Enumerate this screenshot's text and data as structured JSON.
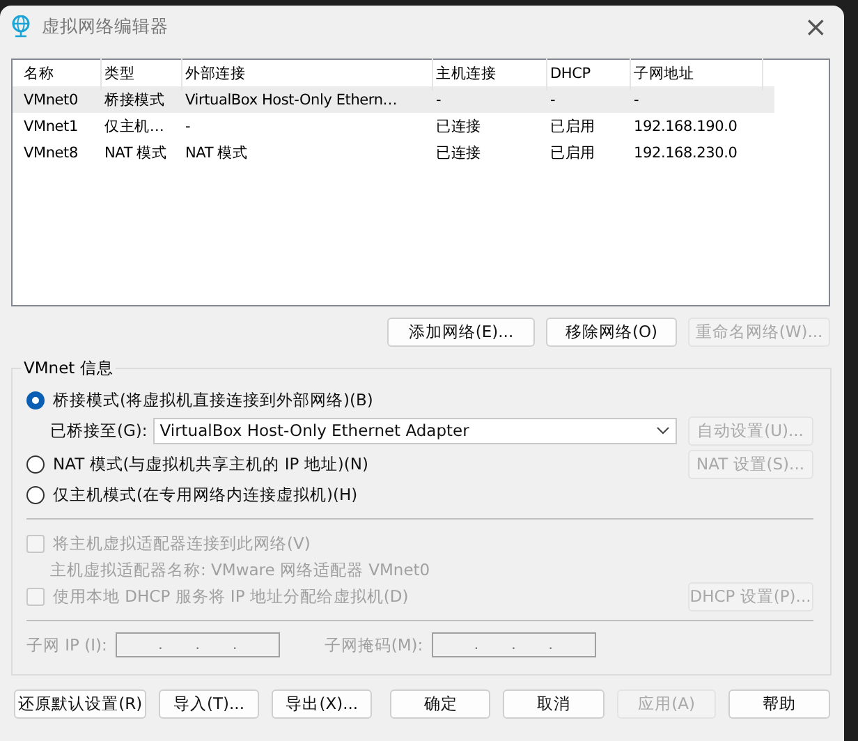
{
  "window": {
    "title": "虚拟网络编辑器",
    "close": "×"
  },
  "table": {
    "columns": [
      "名称",
      "类型",
      "外部连接",
      "主机连接",
      "DHCP",
      "子网地址"
    ],
    "rows": [
      {
        "cells": [
          "VMnet0",
          "桥接模式",
          "VirtualBox Host-Only Ethern…",
          "-",
          "-",
          "-"
        ],
        "selected": true
      },
      {
        "cells": [
          "VMnet1",
          "仅主机…",
          "-",
          "已连接",
          "已启用",
          "192.168.190.0"
        ],
        "selected": false
      },
      {
        "cells": [
          "VMnet8",
          "NAT 模式",
          "NAT 模式",
          "已连接",
          "已启用",
          "192.168.230.0"
        ],
        "selected": false
      }
    ]
  },
  "network_buttons": [
    {
      "label": "添加网络(E)...",
      "disabled": false
    },
    {
      "label": "移除网络(O)",
      "disabled": false
    },
    {
      "label": "重命名网络(W)...",
      "disabled": true
    }
  ],
  "info": {
    "title": "VMnet 信息",
    "modes": [
      {
        "label": "桥接模式(将虚拟机直接连接到外部网络)(B)",
        "selected": true
      },
      {
        "label": "NAT 模式(与虚拟机共享主机的 IP 地址)(N)",
        "selected": false
      },
      {
        "label": "仅主机模式(在专用网络内连接虚拟机)(H)",
        "selected": false
      }
    ],
    "bridged_to": {
      "label": "已桥接至(G):",
      "value": "VirtualBox Host-Only Ethernet Adapter"
    },
    "auto_button": {
      "label": "自动设置(U)...",
      "disabled": true
    },
    "nat_button": {
      "label": "NAT 设置(S)...",
      "disabled": true
    },
    "host_adapter": {
      "label": "将主机虚拟适配器连接到此网络(V)",
      "checked": false,
      "disabled": true
    },
    "adapter_name": "主机虚拟适配器名称: VMware 网络适配器 VMnet0",
    "dhcp": {
      "label": "使用本地 DHCP 服务将 IP 地址分配给虚拟机(D)",
      "checked": false,
      "disabled": true
    },
    "dhcp_button": {
      "label": "DHCP 设置(P)...",
      "disabled": true
    },
    "subnet_ip": {
      "label": "子网 IP (I):",
      "dots": [
        ".",
        ".",
        "."
      ]
    },
    "subnet_mask": {
      "label": "子网掩码(M):",
      "dots": [
        ".",
        ".",
        "."
      ]
    }
  },
  "bottom_buttons": [
    {
      "label": "还原默认设置(R)",
      "disabled": false
    },
    {
      "label": "导入(T)...",
      "disabled": false
    },
    {
      "label": "导出(X)...",
      "disabled": false
    },
    {
      "label": "确定",
      "disabled": false
    },
    {
      "label": "取消",
      "disabled": false
    },
    {
      "label": "应用(A)",
      "disabled": true
    },
    {
      "label": "帮助",
      "disabled": false
    }
  ]
}
